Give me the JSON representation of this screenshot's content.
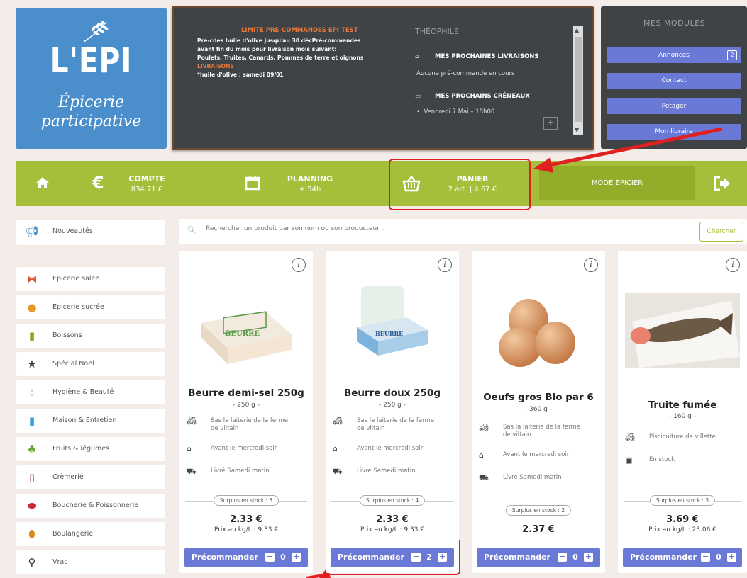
{
  "logo": {
    "brand": "L'EPI",
    "sub1": "Épicerie",
    "sub2": "participative"
  },
  "board": {
    "limit_title": "LIMITE PRE-COMMANDES EPI TEST",
    "desc_line1": "Pré-cdes huile d'olive jusqu'au 30 déc",
    "desc_line1b": "Pré-commandes",
    "desc_line2": "avant fin du mois pour livraison mois suivant:",
    "desc_line3": "Poulets, Truites, Canards, Pommes de terre et oignons",
    "desc_line4": "LIVRAISONS",
    "desc_line5": "*huile d'olive : samedi 09/01",
    "user_name": "THÉOPHILE",
    "deliveries_title": "MES PROCHAINES LIVRAISONS",
    "deliveries_text": "Aucune pré-commande en cours",
    "slots_title": "MES PROCHAINS CRÉNEAUX",
    "slots_item": "Vendredi 7 Mai – 18h00",
    "plus": "+"
  },
  "modules": {
    "title": "MES MODULES",
    "items": [
      {
        "label": "Annonces",
        "badge": "2"
      },
      {
        "label": "Contact"
      },
      {
        "label": "Potager"
      },
      {
        "label": "Mon libraire"
      }
    ]
  },
  "nav": {
    "compte_label": "COMPTE",
    "compte_value": "834.71 €",
    "planning_label": "PLANNING",
    "planning_value": "+ 54h",
    "panier_label": "PANIER",
    "panier_value": "2 art. | 4.67 €",
    "mode_label": "MODE ÉPICIER"
  },
  "categories": [
    {
      "label": "Nouveautés",
      "icon": "megaphone-icon"
    },
    {
      "label": "Epicerie salée",
      "icon": "pasta-icon"
    },
    {
      "label": "Epicerie sucrée",
      "icon": "cookie-icon"
    },
    {
      "label": "Boissons",
      "icon": "bottle-icon"
    },
    {
      "label": "Spécial Noel",
      "icon": "star-icon"
    },
    {
      "label": "Hygiène & Beauté",
      "icon": "drop-icon"
    },
    {
      "label": "Maison & Entretien",
      "icon": "spray-icon"
    },
    {
      "label": "Fruits & légumes",
      "icon": "vegetables-icon"
    },
    {
      "label": "Crèmerie",
      "icon": "milk-icon"
    },
    {
      "label": "Boucherie & Poissonnerie",
      "icon": "meat-icon"
    },
    {
      "label": "Boulangerie",
      "icon": "bread-icon"
    },
    {
      "label": "Vrac",
      "icon": "scoop-icon"
    }
  ],
  "search": {
    "placeholder": "Rechercher un produit par son nom ou son producteur...",
    "button": "Chercher"
  },
  "products": [
    {
      "name": "Beurre demi-sel 250g",
      "weight": "- 250 g -",
      "producer": "Sas la laiterie de la ferme",
      "producer2": "de viltain",
      "order_by": "Avant le mercredi soir",
      "delivery": "Livré Samedi matin",
      "surplus": "Surplus en stock : 5",
      "price": "2.33 €",
      "kg_price": "Prix au kg/L : 9.33 €",
      "qty": "0"
    },
    {
      "name": "Beurre doux 250g",
      "weight": "- 250 g -",
      "producer": "Sas la laiterie de la ferme",
      "producer2": "de viltain",
      "order_by": "Avant le mercredi soir",
      "delivery": "Livré Samedi matin",
      "surplus": "Surplus en stock : 4",
      "price": "2.33 €",
      "kg_price": "Prix au kg/L : 9.33 €",
      "qty": "2"
    },
    {
      "name": "Oeufs gros Bio par 6",
      "weight": "- 360 g -",
      "producer": "Sas la laiterie de la ferme",
      "producer2": "de viltain",
      "order_by": "Avant le mercredi soir",
      "delivery": "Livré Samedi matin",
      "surplus": "Surplus en stock : 2",
      "price": "2.37 €",
      "kg_price": "",
      "qty": "0"
    },
    {
      "name": "Truite fumée",
      "weight": "- 160 g -",
      "producer": "Pisciculture de villette",
      "producer2": "",
      "order_by": "En stock",
      "delivery": "",
      "surplus": "Surplus en stock : 3",
      "price": "3.69 €",
      "kg_price": "Prix au kg/L : 23.06 €",
      "qty": "0"
    }
  ],
  "labels": {
    "preorder": "Précommander",
    "minus": "−",
    "plus": "+",
    "info": "i"
  },
  "colors": {
    "green": "#a6bf3a",
    "blue": "#6979d5",
    "board": "#3f4346",
    "logo": "#4a8fcb",
    "highlight": "#e02020"
  }
}
